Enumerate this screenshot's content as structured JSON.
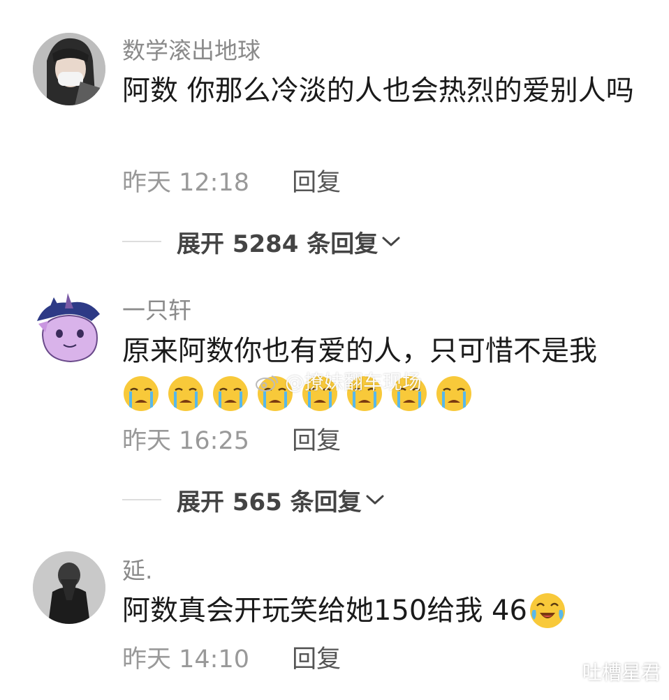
{
  "comments": [
    {
      "username": "数学滚出地球",
      "text": "阿数 你那么冷淡的人也会热烈的爱别人吗",
      "time": "昨天 12:18",
      "reply_label": "回复",
      "expand_label": "展开 5284 条回复"
    },
    {
      "username": "一只轩",
      "text": "原来阿数你也有爱的人，只可惜不是我",
      "emojis": [
        "crying-emoji",
        "crying-emoji",
        "crying-emoji",
        "crying-emoji",
        "crying-emoji",
        "crying-emoji",
        "crying-emoji",
        "crying-emoji"
      ],
      "time": "昨天 16:25",
      "reply_label": "回复",
      "expand_label": "展开 565 条回复"
    },
    {
      "username": "延.",
      "text": "阿数真会开玩笑给她150给我 46",
      "trailing_emoji": "teary-joy-emoji",
      "time": "昨天 14:10",
      "reply_label": "回复"
    }
  ],
  "watermarks": {
    "center": "@撩妹翻车现场",
    "corner": "吐槽星君"
  },
  "colors": {
    "username": "#8a8a8a",
    "content": "#1a1a1a",
    "meta": "#999999",
    "emoji_face": "#f8c93a",
    "tears": "#58b8ea"
  }
}
